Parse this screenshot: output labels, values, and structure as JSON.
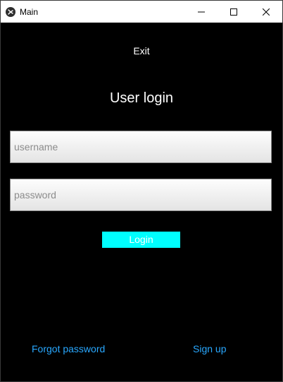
{
  "window": {
    "title": "Main",
    "app_icon": "kivy-icon",
    "controls": {
      "minimize_icon": "minimize-icon",
      "maximize_icon": "maximize-icon",
      "close_icon": "close-icon"
    }
  },
  "form": {
    "exit_label": "Exit",
    "heading": "User login",
    "username_placeholder": "username",
    "username_value": "",
    "password_placeholder": "password",
    "password_value": "",
    "login_label": "Login"
  },
  "footer": {
    "forgot_password_label": "Forgot password",
    "sign_up_label": "Sign up"
  },
  "colors": {
    "background": "#000000",
    "login_button": "#00ffff",
    "link": "#29a8ff",
    "text": "#ffffff"
  }
}
